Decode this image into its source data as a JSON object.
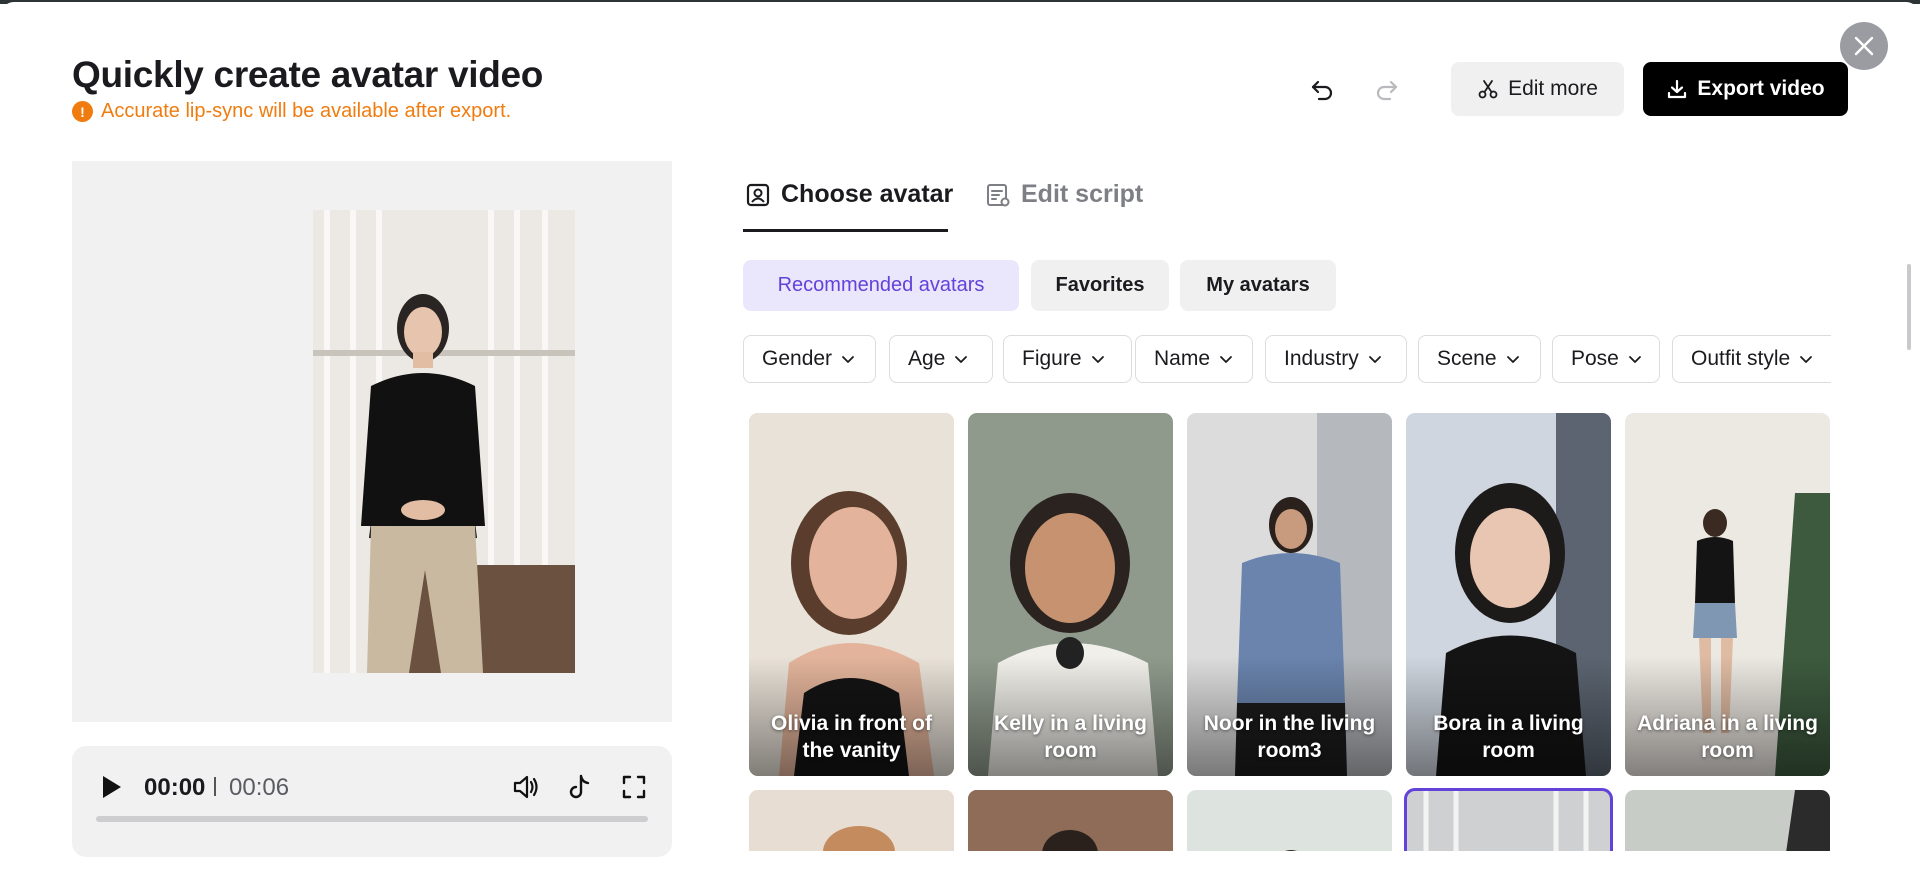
{
  "header": {
    "title": "Quickly create avatar video",
    "warning": "Accurate lip-sync will be available after export.",
    "warning_icon": "!",
    "edit_more": "Edit more",
    "export": "Export video"
  },
  "player": {
    "current_time": "00:00",
    "total_time": "00:06",
    "progress": 0
  },
  "tabs": [
    {
      "label": "Choose avatar",
      "active": true
    },
    {
      "label": "Edit script",
      "active": false
    }
  ],
  "categories": [
    {
      "label": "Recommended avatars",
      "active": true
    },
    {
      "label": "Favorites",
      "active": false
    },
    {
      "label": "My avatars",
      "active": false
    }
  ],
  "filters": [
    "Gender",
    "Age",
    "Figure",
    "Name",
    "Industry",
    "Scene",
    "Pose",
    "Outfit style"
  ],
  "avatars": [
    {
      "name": "Olivia in front of the vanity",
      "bg": "#c9a88e"
    },
    {
      "name": "Kelly in a living room",
      "bg": "#8f9a8c"
    },
    {
      "name": "Noor in the living room3",
      "bg": "#9fa9b8"
    },
    {
      "name": "Bora in a living room",
      "bg": "#6f7784"
    },
    {
      "name": "Adriana in a living room",
      "bg": "#cfc7bd"
    }
  ],
  "avatars_row2": [
    {
      "bg": "#e3d0bf",
      "selected": false
    },
    {
      "bg": "#8a6a55",
      "selected": false
    },
    {
      "bg": "#d7dcd8",
      "selected": false
    },
    {
      "bg": "#c7c8c9",
      "selected": true
    },
    {
      "bg": "#b9bdb7",
      "selected": false
    }
  ],
  "colors": {
    "accent": "#6242d8",
    "warning": "#f07c10",
    "primary_button": "#000000"
  }
}
